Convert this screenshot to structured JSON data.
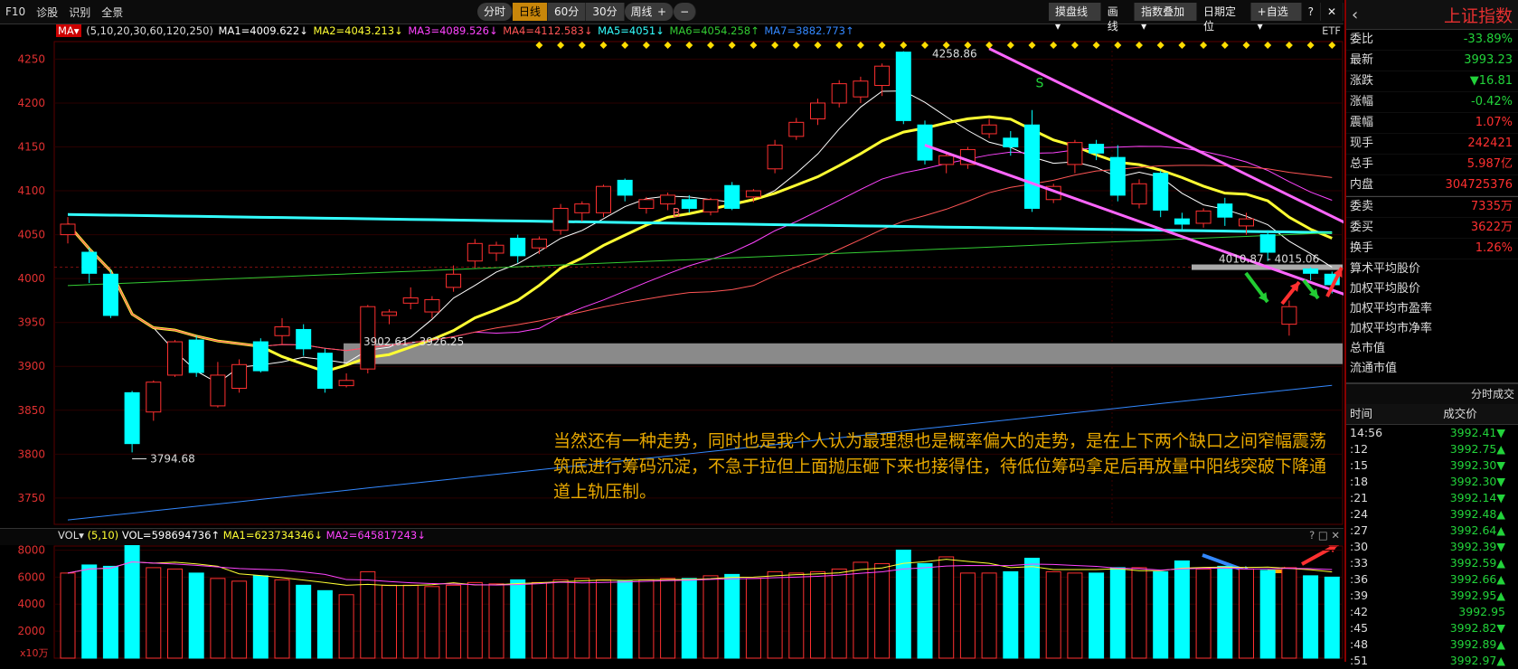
{
  "toolbar": {
    "links": [
      "F10",
      "诊股",
      "识别",
      "全景"
    ],
    "periods": [
      "分时",
      "日线",
      "60分",
      "30分",
      "周线 ▾"
    ],
    "active_period": "日线",
    "zoom": [
      "+",
      "−"
    ],
    "right": [
      "摸盘线 ▾",
      "画线",
      "指数叠加 ▾",
      "日期定位",
      "+自选 ▾",
      "?",
      "✕"
    ]
  },
  "ma_legend": {
    "label": "MA▾",
    "params": "(5,10,20,30,60,120,250)",
    "items": [
      {
        "text": "MA1=4009.622↓",
        "color": "#ffffff"
      },
      {
        "text": "MA2=4043.213↓",
        "color": "#ffff33"
      },
      {
        "text": "MA3=4089.526↓",
        "color": "#ff44ff"
      },
      {
        "text": "MA4=4112.583↓",
        "color": "#ff5555"
      },
      {
        "text": "MA5=4051↓",
        "color": "#33ffff"
      },
      {
        "text": "MA6=4054.258↑",
        "color": "#33cc33"
      },
      {
        "text": "MA7=3882.773↑",
        "color": "#3388ff"
      }
    ],
    "etf": "ETF"
  },
  "vol_legend": {
    "label": "VOL▾",
    "params": "(5,10)",
    "items": [
      {
        "text": "VOL=598694736↑",
        "color": "#ffffff"
      },
      {
        "text": "MA1=623734346↓",
        "color": "#ffff33"
      },
      {
        "text": "MA2=645817243↓",
        "color": "#ff44ff"
      }
    ],
    "icons": "? □ ✕"
  },
  "annotation": "当然还有一种走势，同时也是我个人认为最理想也是概率偏大的走势，是在上下两个缺口之间窄幅震荡筑底进行筹码沉淀，不急于拉但上面抛压砸下来也接得住，待低位筹码拿足后再放量中阳线突破下降通道上轨压制。",
  "chart_data": {
    "type": "candlestick",
    "ylim": [
      3720,
      4270
    ],
    "yticks": [
      3750,
      3800,
      3850,
      3900,
      3950,
      4000,
      4050,
      4100,
      4150,
      4200,
      4250
    ],
    "candles": [
      [
        4050,
        4062,
        4040,
        4070
      ],
      [
        4030,
        4006,
        3995,
        4035
      ],
      [
        4005,
        3958,
        3955,
        4010
      ],
      [
        3870,
        3812,
        3802,
        3872
      ],
      [
        3848,
        3882,
        3838,
        3884
      ],
      [
        3890,
        3928,
        3888,
        3930
      ],
      [
        3930,
        3893,
        3888,
        3935
      ],
      [
        3855,
        3890,
        3853,
        3905
      ],
      [
        3875,
        3902,
        3870,
        3908
      ],
      [
        3928,
        3895,
        3893,
        3932
      ],
      [
        3935,
        3945,
        3925,
        3955
      ],
      [
        3942,
        3920,
        3912,
        3948
      ],
      [
        3915,
        3875,
        3870,
        3920
      ],
      [
        3878,
        3884,
        3876,
        3892
      ],
      [
        3897,
        3968,
        3892,
        3970
      ],
      [
        3958,
        3962,
        3948,
        3965
      ],
      [
        3972,
        3978,
        3965,
        3990
      ],
      [
        3962,
        3976,
        3955,
        3980
      ],
      [
        3990,
        4005,
        3985,
        4015
      ],
      [
        4020,
        4040,
        4012,
        4045
      ],
      [
        4029,
        4038,
        4020,
        4042
      ],
      [
        4046,
        4026,
        4018,
        4050
      ],
      [
        4035,
        4045,
        4028,
        4048
      ],
      [
        4055,
        4080,
        4050,
        4085
      ],
      [
        4075,
        4085,
        4065,
        4088
      ],
      [
        4075,
        4105,
        4070,
        4107
      ],
      [
        4112,
        4095,
        4088,
        4114
      ],
      [
        4080,
        4090,
        4074,
        4093
      ],
      [
        4085,
        4095,
        4078,
        4098
      ],
      [
        4090,
        4080,
        4075,
        4095
      ],
      [
        4076,
        4090,
        4072,
        4092
      ],
      [
        4106,
        4080,
        4078,
        4110
      ],
      [
        4093,
        4100,
        4087,
        4102
      ],
      [
        4125,
        4152,
        4120,
        4158
      ],
      [
        4162,
        4178,
        4158,
        4183
      ],
      [
        4182,
        4200,
        4175,
        4205
      ],
      [
        4200,
        4222,
        4195,
        4226
      ],
      [
        4207,
        4225,
        4200,
        4230
      ],
      [
        4220,
        4242,
        4208,
        4245
      ],
      [
        4258,
        4180,
        4176,
        4259
      ],
      [
        4175,
        4135,
        4130,
        4180
      ],
      [
        4130,
        4140,
        4120,
        4145
      ],
      [
        4130,
        4147,
        4125,
        4150
      ],
      [
        4165,
        4175,
        4160,
        4182
      ],
      [
        4160,
        4150,
        4140,
        4168
      ],
      [
        4175,
        4080,
        4076,
        4192
      ],
      [
        4090,
        4105,
        4086,
        4108
      ],
      [
        4130,
        4155,
        4120,
        4158
      ],
      [
        4153,
        4143,
        4135,
        4158
      ],
      [
        4138,
        4095,
        4088,
        4152
      ],
      [
        4085,
        4108,
        4080,
        4113
      ],
      [
        4120,
        4078,
        4070,
        4123
      ],
      [
        4068,
        4062,
        4055,
        4075
      ],
      [
        4063,
        4077,
        4058,
        4080
      ],
      [
        4085,
        4070,
        4060,
        4092
      ],
      [
        4060,
        4068,
        4050,
        4075
      ],
      [
        4050,
        4030,
        4020,
        4055
      ],
      [
        3948,
        3968,
        3935,
        3975
      ],
      [
        4011,
        4006,
        3998,
        4013
      ],
      [
        4005,
        3993,
        3983,
        4008
      ]
    ],
    "price_labels": {
      "high": "4258.86",
      "low": "3794.68",
      "gap_low": "3902.61 - 3926.25",
      "gap_high": "4010.87 - 4015.06",
      "buy": "B",
      "sell": "S"
    },
    "gaps": [
      [
        3902.61,
        3926.25
      ],
      [
        4010.87,
        4015.06
      ]
    ],
    "channel": [
      [
        43,
        4262
      ],
      [
        64,
        4005
      ],
      [
        40,
        4152
      ],
      [
        64,
        3948
      ]
    ],
    "vol": {
      "ylim": [
        0,
        8300
      ],
      "yticks": [
        2000,
        4000,
        6000,
        8000
      ],
      "tick_labels": [
        "2000",
        "4000",
        "6000",
        "8000"
      ],
      "unit": "x10万",
      "bars": [
        6300,
        6900,
        6800,
        8500,
        6700,
        6600,
        6300,
        5900,
        5700,
        6100,
        5800,
        5400,
        5000,
        4700,
        6400,
        5400,
        5400,
        5300,
        5400,
        5600,
        5500,
        5800,
        5600,
        5800,
        5900,
        5800,
        5700,
        5800,
        5900,
        5900,
        6100,
        6200,
        5900,
        6400,
        6300,
        6400,
        6600,
        7100,
        7000,
        8000,
        7000,
        7500,
        6300,
        6300,
        6400,
        7400,
        6400,
        6300,
        6300,
        6700,
        6700,
        6400,
        7200,
        6600,
        6800,
        6600,
        6500,
        6700,
        6100,
        6000
      ]
    }
  },
  "panel": {
    "title": "上证指数",
    "stats": [
      {
        "k": "委比",
        "v": "-33.89%",
        "c": "g"
      },
      {
        "k": "最新",
        "v": "3993.23",
        "c": "g"
      },
      {
        "k": "涨跌",
        "v": "▼16.81",
        "c": "g"
      },
      {
        "k": "涨幅",
        "v": "-0.42%",
        "c": "g"
      },
      {
        "k": "震幅",
        "v": "1.07%",
        "c": "r"
      },
      {
        "k": "现手",
        "v": "242421",
        "c": "r"
      },
      {
        "k": "总手",
        "v": "5.987亿",
        "c": "r"
      },
      {
        "k": "内盘",
        "v": "304725376",
        "c": "r"
      },
      {
        "k": "委卖",
        "v": "7335万",
        "c": "r"
      },
      {
        "k": "委买",
        "v": "3622万",
        "c": "r"
      },
      {
        "k": "换手",
        "v": "1.26%",
        "c": "r"
      }
    ],
    "labels": [
      "算术平均股价",
      "加权平均股价",
      "加权平均市盈率",
      "加权平均市净率",
      "总市值",
      "流通市值"
    ],
    "trade_title": "分时成交",
    "trade_cols": [
      "时间",
      "成交价"
    ],
    "trades": [
      {
        "t": "14:56",
        "p": "3992.41▼",
        "c": "g"
      },
      {
        "t": ":12",
        "p": "3992.75▲",
        "c": "g"
      },
      {
        "t": ":15",
        "p": "3992.30▼",
        "c": "g"
      },
      {
        "t": ":18",
        "p": "3992.30▼",
        "c": "g"
      },
      {
        "t": ":21",
        "p": "3992.14▼",
        "c": "g"
      },
      {
        "t": ":24",
        "p": "3992.48▲",
        "c": "g"
      },
      {
        "t": ":27",
        "p": "3992.64▲",
        "c": "g"
      },
      {
        "t": ":30",
        "p": "3992.39▼",
        "c": "g"
      },
      {
        "t": ":33",
        "p": "3992.59▲",
        "c": "g"
      },
      {
        "t": ":36",
        "p": "3992.66▲",
        "c": "g"
      },
      {
        "t": ":39",
        "p": "3992.95▲",
        "c": "g"
      },
      {
        "t": ":42",
        "p": "3992.95",
        "c": "g"
      },
      {
        "t": ":45",
        "p": "3992.82▼",
        "c": "g"
      },
      {
        "t": ":48",
        "p": "3992.89▲",
        "c": "g"
      },
      {
        "t": ":51",
        "p": "3992.97▲",
        "c": "g"
      }
    ]
  }
}
